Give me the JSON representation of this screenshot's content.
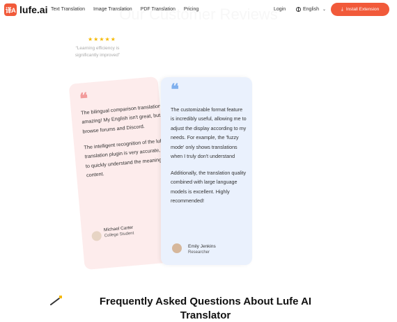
{
  "header": {
    "brand": "lufe.ai",
    "logo_text": "译A",
    "nav": [
      "Text Translation",
      "Image Translation",
      "PDF Translation",
      "Pricing"
    ],
    "login": "Login",
    "language": "English",
    "install_label": "Install Extension",
    "accent": "#f15a3a"
  },
  "section": {
    "title": "Our Customer Reviews"
  },
  "small_review": {
    "stars": "★★★★★",
    "quote": "“Learning efficiency is significantly improved”"
  },
  "review_back": {
    "quote_mark": "❝",
    "paragraph1": "The bilingual comparison translation feature is amazing! My English isn't great, but I often browse forums and Discord.",
    "paragraph2": "The intelligent recognition of the lufe.ai web translation plugin is very accurate, allowing me to quickly understand the meaning of the content.",
    "author": "Michael Carter",
    "role": "College Student"
  },
  "review_front": {
    "quote_mark": "❝",
    "paragraph1": "The customizable format feature is incredibly useful, allowing me to adjust the display according to my needs. For example, the 'fuzzy mode' only shows translations when I truly don't understand",
    "paragraph2": "Additionally, the translation quality combined with large language models is excellent. Highly recommended!",
    "author": "Emily Jenkins",
    "role": "Researcher"
  },
  "faq": {
    "title": "Frequently Asked Questions About Lufe AI Translator"
  }
}
